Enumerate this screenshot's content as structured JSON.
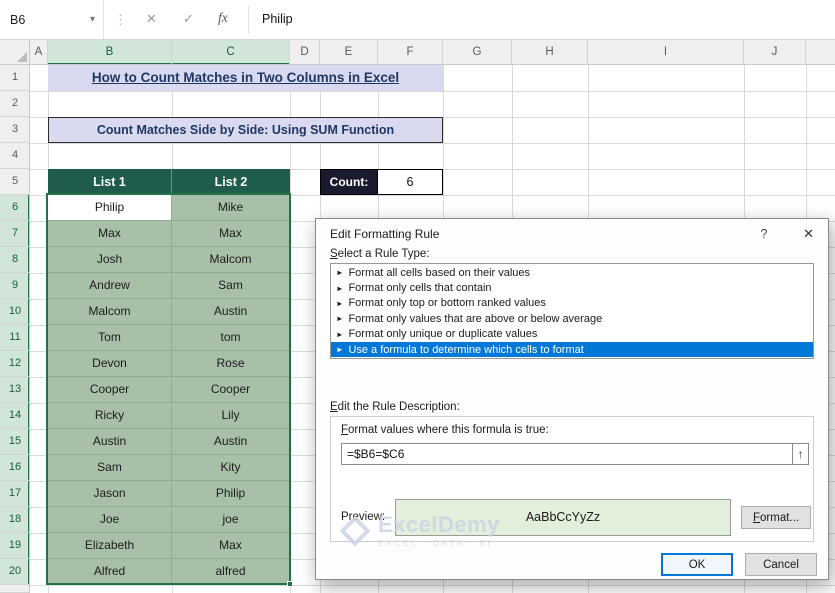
{
  "formula_bar": {
    "name_box_value": "B6",
    "formula_value": "Philip"
  },
  "icons": {
    "caret": "▾",
    "dots": "⋮",
    "cancel": "✕",
    "enter": "✓",
    "fx": "fx",
    "help": "?",
    "close": "✕",
    "range_picker": "↑",
    "rule_arrow": "►"
  },
  "grid": {
    "column_headers": [
      "A",
      "B",
      "C",
      "D",
      "E",
      "F",
      "G",
      "H",
      "I",
      "J"
    ],
    "row_headers": [
      "1",
      "2",
      "3",
      "4",
      "5",
      "6",
      "7",
      "8",
      "9",
      "10",
      "11",
      "12",
      "13",
      "14",
      "15",
      "16",
      "17",
      "18",
      "19",
      "20"
    ]
  },
  "sheet": {
    "title": "How to Count Matches in Two Columns in Excel",
    "section_title": "Count Matches Side by Side: Using SUM Function",
    "table": {
      "headers": [
        "List 1",
        "List 2"
      ],
      "rows": [
        [
          "Philip",
          "Mike"
        ],
        [
          "Max",
          "Max"
        ],
        [
          "Josh",
          "Malcom"
        ],
        [
          "Andrew",
          "Sam"
        ],
        [
          "Malcom",
          "Austin"
        ],
        [
          "Tom",
          "tom"
        ],
        [
          "Devon",
          "Rose"
        ],
        [
          "Cooper",
          "Cooper"
        ],
        [
          "Ricky",
          "Lily"
        ],
        [
          "Austin",
          "Austin"
        ],
        [
          "Sam",
          "Kity"
        ],
        [
          "Jason",
          "Philip"
        ],
        [
          "Joe",
          "joe"
        ],
        [
          "Elizabeth",
          "Max"
        ],
        [
          "Alfred",
          "alfred"
        ]
      ]
    },
    "count_label": "Count:",
    "count_value": "6",
    "active_cell": "B6",
    "selected_range": "B6:C20"
  },
  "dialog": {
    "title": "Edit Formatting Rule",
    "rule_type_label": "Select a Rule Type:",
    "rule_types": [
      "Format all cells based on their values",
      "Format only cells that contain",
      "Format only top or bottom ranked values",
      "Format only values that are above or below average",
      "Format only unique or duplicate values",
      "Use a formula to determine which cells to format"
    ],
    "selected_rule_index": 5,
    "description_label": "Edit the Rule Description:",
    "formula_label": "Format values where this formula is true:",
    "formula_value": "=$B6=$C6",
    "preview_label": "Preview:",
    "preview_text": "AaBbCcYyZz",
    "format_button": "Format...",
    "ok_button": "OK",
    "cancel_button": "Cancel"
  },
  "watermark": {
    "name": "ExcelDemy",
    "tagline": "EXCEL · DATA · BI"
  },
  "colors": {
    "accent_green": "#217346",
    "table_header_green": "#1F5C4B",
    "cell_green": "#A8C0A8",
    "lavender": "#D9D9F0",
    "navy_text": "#1F3864",
    "selection_blue": "#0078D7",
    "preview_green": "#E2EFDA",
    "count_bg": "#1A1A2E"
  }
}
